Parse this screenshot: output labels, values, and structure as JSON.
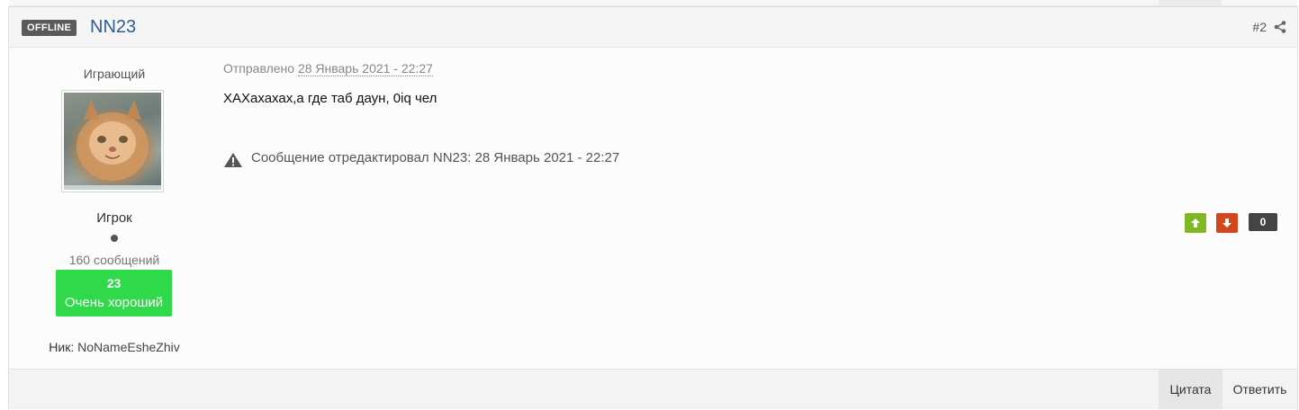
{
  "header": {
    "status_badge": "OFFLINE",
    "author_name": "NN23",
    "post_number": "#2",
    "share_icon": "share-icon"
  },
  "author": {
    "group": "Играющий",
    "avatar_icon": "cat-avatar",
    "rank": "Игрок",
    "post_count": "160 сообщений",
    "reputation": {
      "value": "23",
      "label": "Очень хороший",
      "color": "#2fd94a"
    },
    "nick_label": "Ник:",
    "nick_value": "NoNameEsheZhiv"
  },
  "post": {
    "posted_label": "Отправлено",
    "posted_date": "28 Январь 2021 - 22:27",
    "body": "ХАХахахах,а где таб даун, 0iq чел",
    "edit_icon": "warning-icon",
    "edit_note": "Сообщение отредактировал NN23: 28 Январь 2021 - 22:27"
  },
  "reputation_controls": {
    "up_icon": "arrow-up-icon",
    "down_icon": "arrow-down-icon",
    "count": "0",
    "up_color": "#80b822",
    "down_color": "#d4461b"
  },
  "footer": {
    "quote_label": "Цитата",
    "reply_label": "Ответить"
  }
}
